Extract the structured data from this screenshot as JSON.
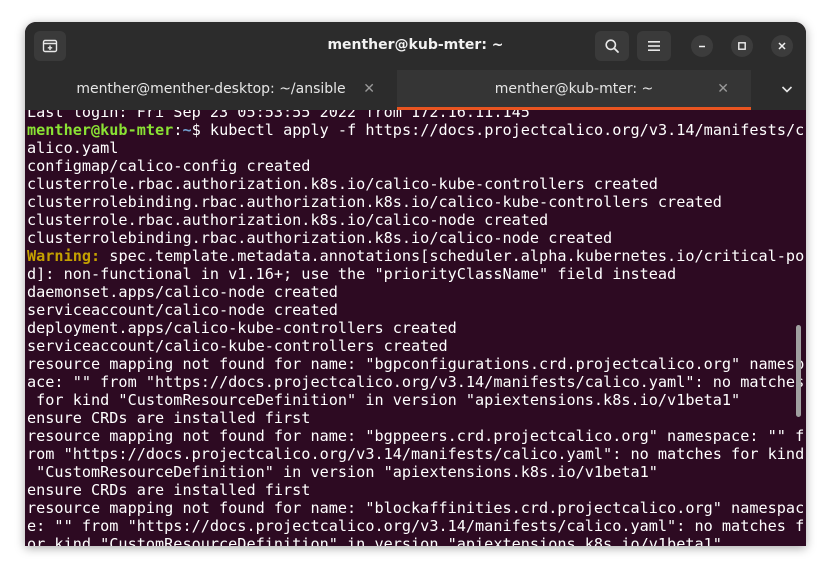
{
  "window": {
    "title": "menther@kub-mter: ~"
  },
  "icons": {
    "new_tab": "new-tab-icon",
    "search": "search-icon",
    "menu": "hamburger-menu-icon",
    "minimize": "minimize-icon",
    "maximize": "maximize-icon",
    "close": "close-icon",
    "tab_close": "tab-close-icon",
    "tab_list": "chevron-down-icon"
  },
  "colors": {
    "terminal_bg": "#2d0a22",
    "prompt_user": "#8ae234",
    "prompt_path": "#729fcf",
    "warning": "#c4a000",
    "tab_accent": "#e95420"
  },
  "tabs": [
    {
      "label": "menther@menther-desktop: ~/ansible",
      "active": false
    },
    {
      "label": "menther@kub-mter: ~",
      "active": true
    }
  ],
  "terminal": {
    "partial_top_line": "Last login: Fri Sep 23 05:53:55 2022 from 172.16.11.145",
    "prompt_user": "menther@kub-mter",
    "prompt_sep": ":",
    "prompt_path": "~",
    "prompt_symbol": "$ ",
    "command_line1": "kubectl apply -f https://docs.projectcalico.org/v3.14/manifests/c",
    "command_line2": "alico.yaml",
    "out1": "configmap/calico-config created",
    "out2": "clusterrole.rbac.authorization.k8s.io/calico-kube-controllers created",
    "out3": "clusterrolebinding.rbac.authorization.k8s.io/calico-kube-controllers created",
    "out4": "clusterrole.rbac.authorization.k8s.io/calico-node created",
    "out5": "clusterrolebinding.rbac.authorization.k8s.io/calico-node created",
    "warning_label": "Warning:",
    "warning_text1": " spec.template.metadata.annotations[scheduler.alpha.kubernetes.io/critical-po",
    "warning_text2": "d]: non-functional in v1.16+; use the \"priorityClassName\" field instead",
    "out6": "daemonset.apps/calico-node created",
    "out7": "serviceaccount/calico-node created",
    "out8": "deployment.apps/calico-kube-controllers created",
    "out9": "serviceaccount/calico-kube-controllers created",
    "err1a": "resource mapping not found for name: \"bgpconfigurations.crd.projectcalico.org\" namesp",
    "err1b": "ace: \"\" from \"https://docs.projectcalico.org/v3.14/manifests/calico.yaml\": no matches",
    "err1c": " for kind \"CustomResourceDefinition\" in version \"apiextensions.k8s.io/v1beta1\"",
    "err1d": "ensure CRDs are installed first",
    "err2a": "resource mapping not found for name: \"bgppeers.crd.projectcalico.org\" namespace: \"\" f",
    "err2b": "rom \"https://docs.projectcalico.org/v3.14/manifests/calico.yaml\": no matches for kind",
    "err2c": " \"CustomResourceDefinition\" in version \"apiextensions.k8s.io/v1beta1\"",
    "err2d": "ensure CRDs are installed first",
    "err3a": "resource mapping not found for name: \"blockaffinities.crd.projectcalico.org\" namespac",
    "err3b": "e: \"\" from \"https://docs.projectcalico.org/v3.14/manifests/calico.yaml\": no matches f",
    "err3c": "or kind \"CustomResourceDefinition\" in version \"apiextensions.k8s.io/v1beta1\""
  }
}
